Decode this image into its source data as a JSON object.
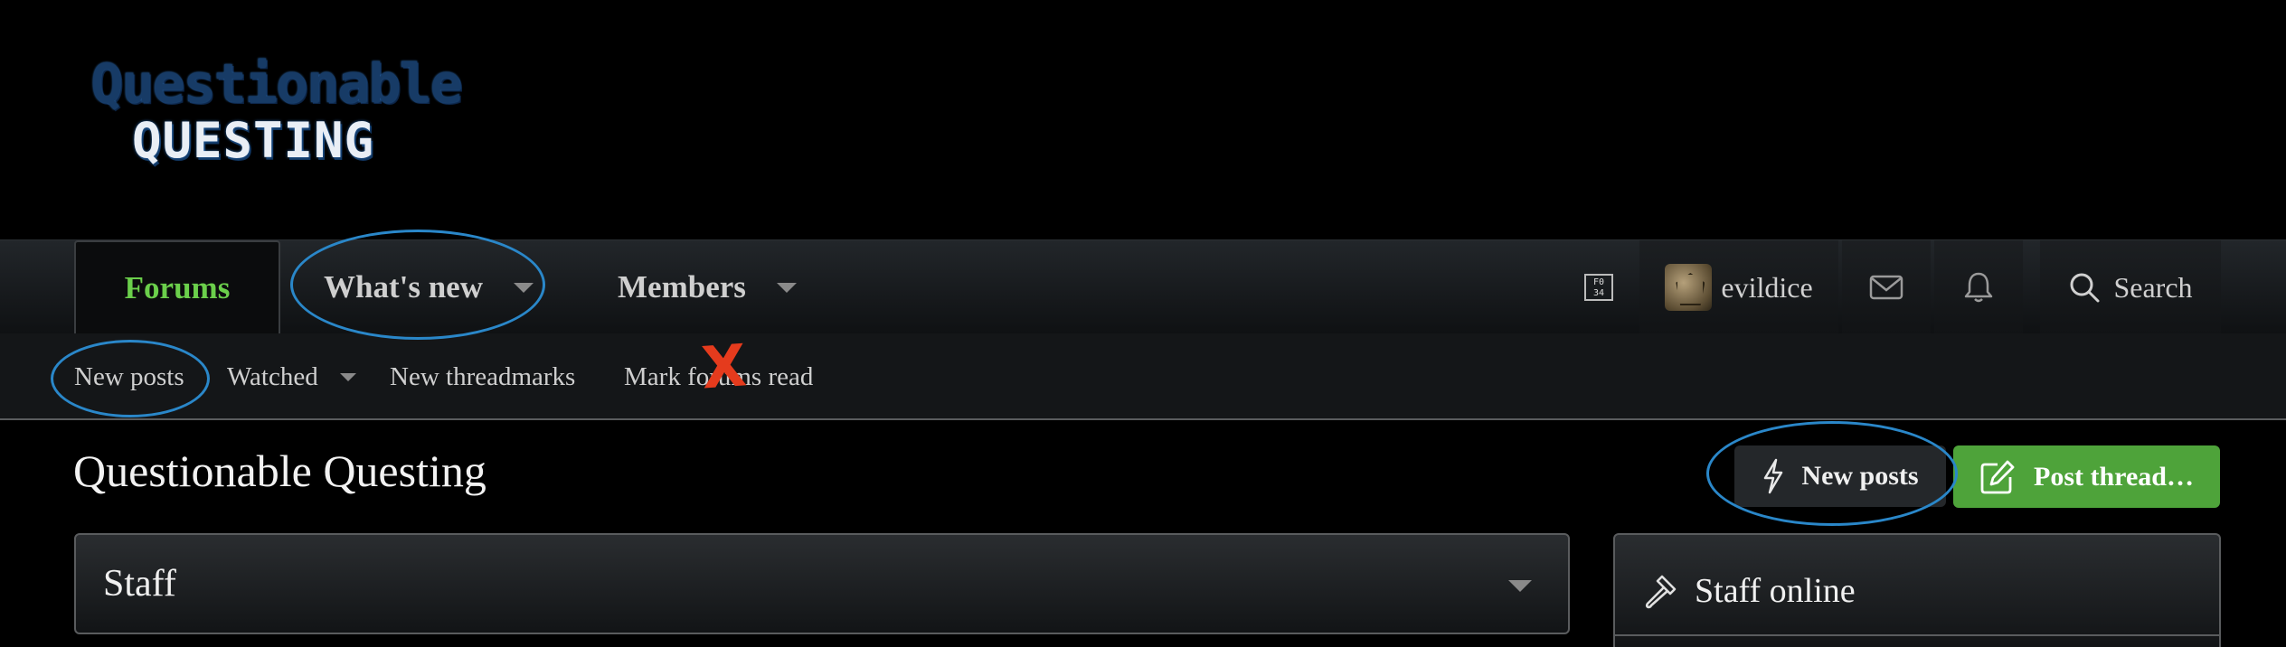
{
  "logo": {
    "line1": "Questionable",
    "line2": "QUESTING"
  },
  "nav": {
    "tabs": [
      {
        "label": "Forums",
        "active": true
      },
      {
        "label": "What's new"
      },
      {
        "label": "Members"
      }
    ],
    "right": {
      "username": "evildice",
      "search_label": "Search",
      "badge_icon": "F0 34"
    }
  },
  "subnav": {
    "items": [
      {
        "label": "New posts"
      },
      {
        "label": "Watched"
      },
      {
        "label": "New threadmarks"
      },
      {
        "label": "Mark forums read"
      }
    ]
  },
  "page": {
    "title": "Questionable Questing",
    "new_posts_button": "New posts",
    "post_thread_button": "Post thread…"
  },
  "blocks": {
    "staff_title": "Staff",
    "staff_online_title": "Staff online"
  },
  "colors": {
    "accent_green": "#6bcf4b",
    "post_button": "#4ea33a",
    "annotation_blue": "#2a87c9",
    "annotation_red": "#e53b1d"
  }
}
